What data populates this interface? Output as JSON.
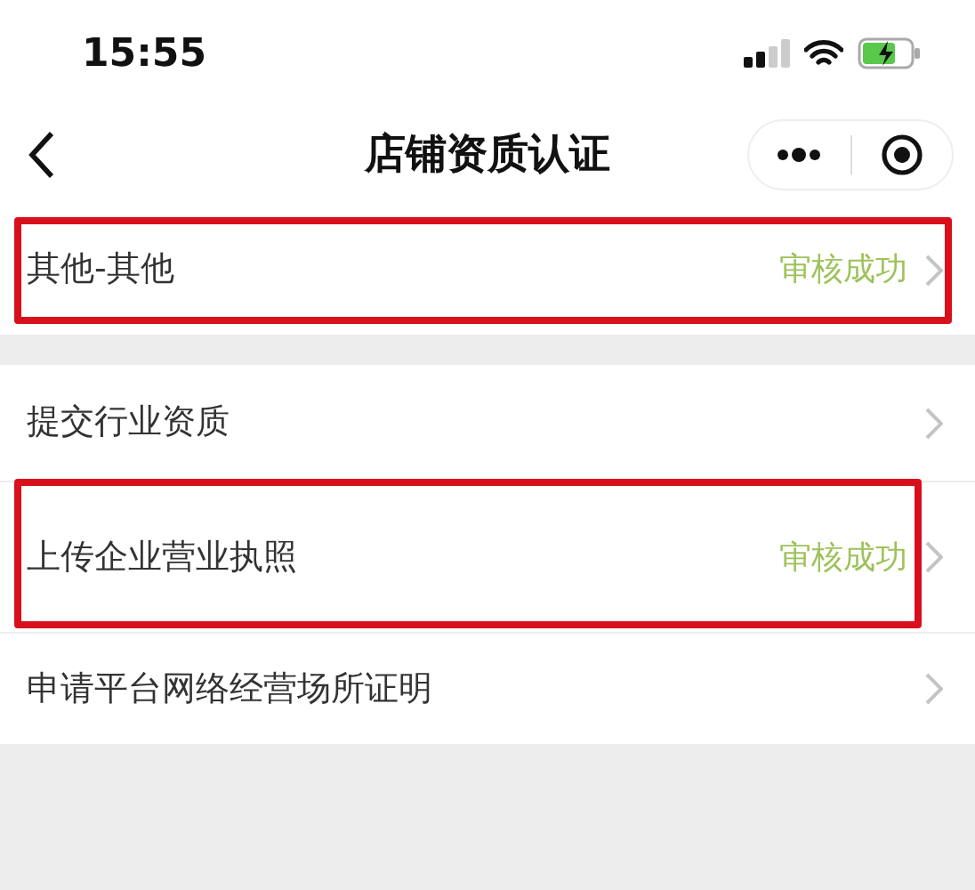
{
  "status_bar": {
    "time": "15:55"
  },
  "nav": {
    "title": "店铺资质认证"
  },
  "groups": [
    {
      "rows": [
        {
          "label": "其他-其他",
          "status": "审核成功",
          "highlighted": true
        }
      ]
    },
    {
      "rows": [
        {
          "label": "提交行业资质",
          "highlighted": false
        },
        {
          "label": "上传企业营业执照",
          "status": "审核成功",
          "highlighted": true
        },
        {
          "label": "申请平台网络经营场所证明",
          "highlighted": false
        }
      ]
    }
  ]
}
